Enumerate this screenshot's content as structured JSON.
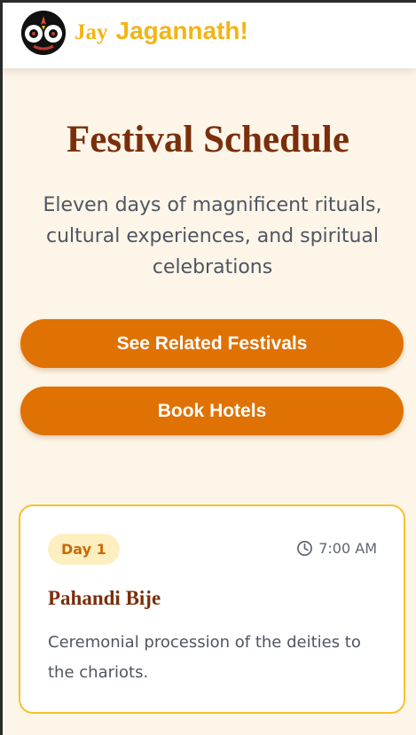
{
  "header": {
    "logo_icon": "jagannath-face-icon",
    "brand_prefix": "Jay",
    "brand_name": "Jagannath!"
  },
  "hero": {
    "title": "Festival Schedule",
    "subtitle": "Eleven days of magnificent rituals, cultural experiences, and spiritual celebrations"
  },
  "actions": {
    "related_label": "See Related Festivals",
    "hotels_label": "Book Hotels"
  },
  "schedule": [
    {
      "day": "Day 1",
      "time": "7:00 AM",
      "time_icon": "clock-icon",
      "title": "Pahandi Bije",
      "description": "Ceremonial procession of the deities to the chariots."
    }
  ],
  "colors": {
    "brand_yellow": "#f3b414",
    "button_orange": "#e07103",
    "title_brown": "#7a2e0b",
    "card_border": "#f7c12d",
    "badge_bg": "#fdefc0",
    "page_bg": "#fdf6e8"
  }
}
